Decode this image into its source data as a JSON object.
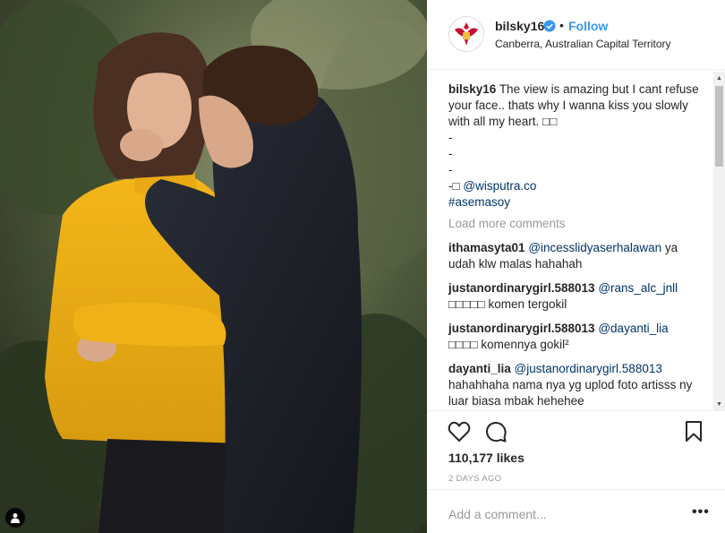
{
  "post": {
    "username": "bilsky16",
    "verified": true,
    "follow_label": "Follow",
    "separator": "•",
    "location": "Canberra, Australian Capital Territory"
  },
  "caption": {
    "username": "bilsky16",
    "text": "The view is amazing but I cant refuse your face.. thats why I wanna kiss you slowly with all my heart. □□",
    "line1": "-",
    "line2": "-",
    "line3": "-",
    "credit_prefix": "-□ ",
    "credit_mention": "@wisputra.co",
    "hashtag": "#asemasoy"
  },
  "load_more": "Load more comments",
  "comments": [
    {
      "user": "ithamasyta01",
      "mention": "@incesslidyaserhalawan",
      "text": " ya udah klw malas hahahah"
    },
    {
      "user": "justanordinarygirl.588013",
      "mention": "@rans_alc_jnll",
      "text": " □□□□□ komen tergokil"
    },
    {
      "user": "justanordinarygirl.588013",
      "mention": "@dayanti_lia",
      "text": " □□□□ komennya gokil²"
    },
    {
      "user": "dayanti_lia",
      "mention": "@justanordinarygirl.588013",
      "text": " hahahhaha nama nya yg uplod foto artisss ny luar biasa mbak hehehee"
    }
  ],
  "likes": "110,177 likes",
  "timestamp": "2 DAYS AGO",
  "add_comment_placeholder": "Add a comment...",
  "more_label": "•••",
  "icons": {
    "like": "heart-icon",
    "comment": "comment-bubble-icon",
    "save": "bookmark-icon",
    "tag": "user-tag-icon",
    "verified": "verified-badge-icon"
  },
  "colors": {
    "link": "#3897f0",
    "mention": "#003569",
    "muted": "#999999"
  }
}
